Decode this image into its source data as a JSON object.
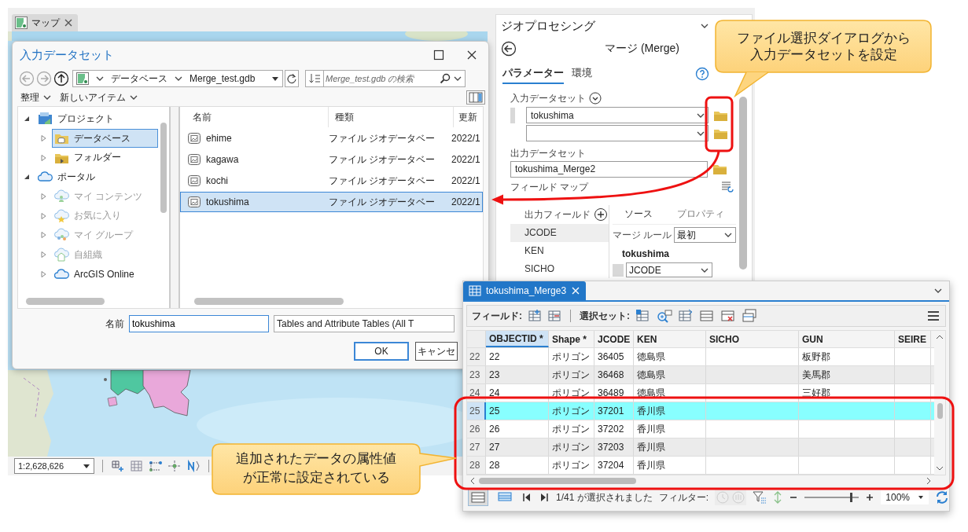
{
  "map": {
    "tab": {
      "label": "マップ",
      "selected": true
    },
    "scale": "1:2,628,626"
  },
  "file_dialog": {
    "title": "入力データセット",
    "path": [
      "データベース",
      "Merge_test.gdb"
    ],
    "search": {
      "placeholder": "Merge_test.gdb の検索"
    },
    "toolbar": [
      "整理",
      "新しいアイテム"
    ],
    "tree": [
      {
        "label": "プロジェクト",
        "kind": "project",
        "expanded": true,
        "selected": false,
        "disabled": false,
        "children": [
          {
            "label": "データベース",
            "kind": "database",
            "expanded": false,
            "selected": true,
            "disabled": false
          },
          {
            "label": "フォルダー",
            "kind": "folder",
            "expanded": false,
            "selected": false,
            "disabled": false
          }
        ]
      },
      {
        "label": "ポータル",
        "kind": "portal",
        "expanded": true,
        "selected": false,
        "disabled": false,
        "children": [
          {
            "label": "マイ コンテンツ",
            "kind": "content",
            "expanded": false,
            "selected": false,
            "disabled": true
          },
          {
            "label": "お気に入り",
            "kind": "favorites",
            "expanded": false,
            "selected": false,
            "disabled": true
          },
          {
            "label": "マイ グループ",
            "kind": "groups",
            "expanded": false,
            "selected": false,
            "disabled": true
          },
          {
            "label": "自組織",
            "kind": "organization",
            "expanded": false,
            "selected": false,
            "disabled": true
          },
          {
            "label": "ArcGIS Online",
            "kind": "portal",
            "expanded": false,
            "selected": false,
            "disabled": false
          }
        ]
      }
    ],
    "columns": [
      "名前",
      "種類",
      "更新"
    ],
    "files": [
      {
        "name": "ehime",
        "type": "ファイル ジオデータベー",
        "modified": "2022/1",
        "selected": false
      },
      {
        "name": "kagawa",
        "type": "ファイル ジオデータベー",
        "modified": "2022/1",
        "selected": false
      },
      {
        "name": "kochi",
        "type": "ファイル ジオデータベー",
        "modified": "2022/1",
        "selected": false
      },
      {
        "name": "tokushima",
        "type": "ファイル ジオデータベー",
        "modified": "2022/1",
        "selected": true
      }
    ],
    "name_label": "名前",
    "name_value": "tokushima",
    "filter": "Tables and Attribute Tables (All T",
    "buttons": [
      "OK",
      "キャンセ"
    ]
  },
  "geoprocessing": {
    "title": "ジオプロセシング",
    "tool": "マージ (Merge)",
    "tabs": [
      {
        "label": "パラメーター",
        "selected": true
      },
      {
        "label": "環境",
        "selected": false
      }
    ],
    "input_label": "入力データセット",
    "inputs": [
      "tokushima"
    ],
    "output_label": "出力データセット",
    "output_value": "tokushima_Merge2",
    "field_map_label": "フィールド マップ",
    "output_fields_label": "出力フィールド",
    "fields": [
      {
        "name": "JCODE",
        "selected": true
      },
      {
        "name": "KEN",
        "selected": false
      },
      {
        "name": "SICHO",
        "selected": false
      }
    ],
    "source_tabs": [
      {
        "label": "ソース",
        "selected": true
      },
      {
        "label": "プロパティ",
        "selected": false
      }
    ],
    "merge_rule_label": "マージ ルール",
    "merge_rule": "最初",
    "source_name": "tokushima",
    "source_field": "JCODE"
  },
  "attribute_table": {
    "title": "tokushima_Merge3",
    "field_label": "フィールド:",
    "selection_label": "選択セット:",
    "columns": [
      {
        "label": "OBJECTID *",
        "selected": true
      },
      {
        "label": "Shape *",
        "selected": false
      },
      {
        "label": "JCODE",
        "selected": false
      },
      {
        "label": "KEN",
        "selected": false
      },
      {
        "label": "SICHO",
        "selected": false
      },
      {
        "label": "GUN",
        "selected": false
      },
      {
        "label": "SEIRE",
        "selected": false
      }
    ],
    "rows": [
      {
        "row": "22",
        "objectid": "22",
        "shape": "ポリゴン",
        "jcode": "36405",
        "ken": "徳島県",
        "gun": "板野郡",
        "selected": false
      },
      {
        "row": "23",
        "objectid": "23",
        "shape": "ポリゴン",
        "jcode": "36468",
        "ken": "徳島県",
        "gun": "美馬郡",
        "selected": false
      },
      {
        "row": "24",
        "objectid": "24",
        "shape": "ポリゴン",
        "jcode": "36489",
        "ken": "徳島県",
        "gun": "三好郡",
        "selected": false
      },
      {
        "row": "25",
        "objectid": "25",
        "shape": "ポリゴン",
        "jcode": "37201",
        "ken": "香川県",
        "selected": true
      },
      {
        "row": "26",
        "objectid": "26",
        "shape": "ポリゴン",
        "jcode": "37202",
        "ken": "香川県",
        "selected": false
      },
      {
        "row": "27",
        "objectid": "27",
        "shape": "ポリゴン",
        "jcode": "37203",
        "ken": "香川県",
        "selected": false
      },
      {
        "row": "28",
        "objectid": "28",
        "shape": "ポリゴン",
        "jcode": "37204",
        "ken": "香川県",
        "selected": false
      }
    ],
    "status": "1/41 が選択されました",
    "filter_label": "フィルター:",
    "zoom": "100%",
    "zoom_slider": {
      "level": 0.85
    }
  },
  "callouts": [
    {
      "lines": [
        "ファイル選択ダイアログから",
        "入力データセットを設定"
      ]
    },
    {
      "lines": [
        "追加されたデータの属性値",
        "が正常に設定されている"
      ]
    }
  ]
}
